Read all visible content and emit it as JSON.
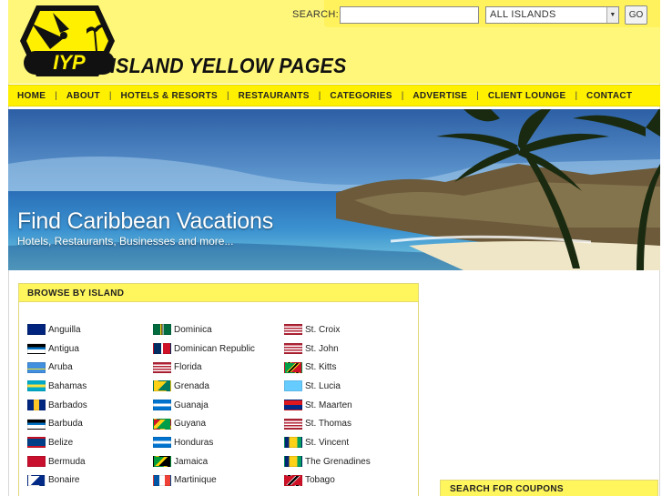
{
  "site": {
    "logo_text": "IYP",
    "title": "ISLAND YELLOW PAGES"
  },
  "search": {
    "label": "SEARCH:",
    "value": "",
    "placeholder": "",
    "island_select": "ALL ISLANDS",
    "go_label": "GO"
  },
  "nav": {
    "items": [
      {
        "label": "HOME"
      },
      {
        "label": "ABOUT"
      },
      {
        "label": "HOTELS & RESORTS"
      },
      {
        "label": "RESTAURANTS"
      },
      {
        "label": "CATEGORIES"
      },
      {
        "label": "ADVERTISE"
      },
      {
        "label": "CLIENT LOUNGE"
      },
      {
        "label": "CONTACT"
      }
    ],
    "separator": "|"
  },
  "hero": {
    "title": "Find Caribbean Vacations",
    "subtitle": "Hotels, Restaurants, Businesses and more..."
  },
  "browse": {
    "heading": "BROWSE BY ISLAND",
    "columns": [
      [
        {
          "name": "Anguilla",
          "flag": "anguilla"
        },
        {
          "name": "Antigua",
          "flag": "antigua"
        },
        {
          "name": "Aruba",
          "flag": "aruba"
        },
        {
          "name": "Bahamas",
          "flag": "bahamas"
        },
        {
          "name": "Barbados",
          "flag": "barbados"
        },
        {
          "name": "Barbuda",
          "flag": "antigua"
        },
        {
          "name": "Belize",
          "flag": "belize"
        },
        {
          "name": "Bermuda",
          "flag": "bermuda"
        },
        {
          "name": "Bonaire",
          "flag": "bonaire"
        }
      ],
      [
        {
          "name": "Dominica",
          "flag": "dominica"
        },
        {
          "name": "Dominican Republic",
          "flag": "dominican-republic"
        },
        {
          "name": "Florida",
          "flag": "usa"
        },
        {
          "name": "Grenada",
          "flag": "grenada"
        },
        {
          "name": "Guanaja",
          "flag": "honduras"
        },
        {
          "name": "Guyana",
          "flag": "guyana"
        },
        {
          "name": "Honduras",
          "flag": "honduras"
        },
        {
          "name": "Jamaica",
          "flag": "jamaica"
        },
        {
          "name": "Martinique",
          "flag": "france"
        }
      ],
      [
        {
          "name": "St. Croix",
          "flag": "usa"
        },
        {
          "name": "St. John",
          "flag": "usa"
        },
        {
          "name": "St. Kitts",
          "flag": "st-kitts"
        },
        {
          "name": "St. Lucia",
          "flag": "st-lucia"
        },
        {
          "name": "St. Maarten",
          "flag": "st-maarten"
        },
        {
          "name": "St. Thomas",
          "flag": "usa"
        },
        {
          "name": "St. Vincent",
          "flag": "st-vincent"
        },
        {
          "name": "The Grenadines",
          "flag": "st-vincent"
        },
        {
          "name": "Tobago",
          "flag": "trinidad"
        }
      ]
    ]
  },
  "coupons": {
    "heading": "SEARCH FOR COUPONS"
  },
  "colors": {
    "header_bg": "#fff77a",
    "nav_bg": "#fff000",
    "panel_head": "#fff55c"
  }
}
